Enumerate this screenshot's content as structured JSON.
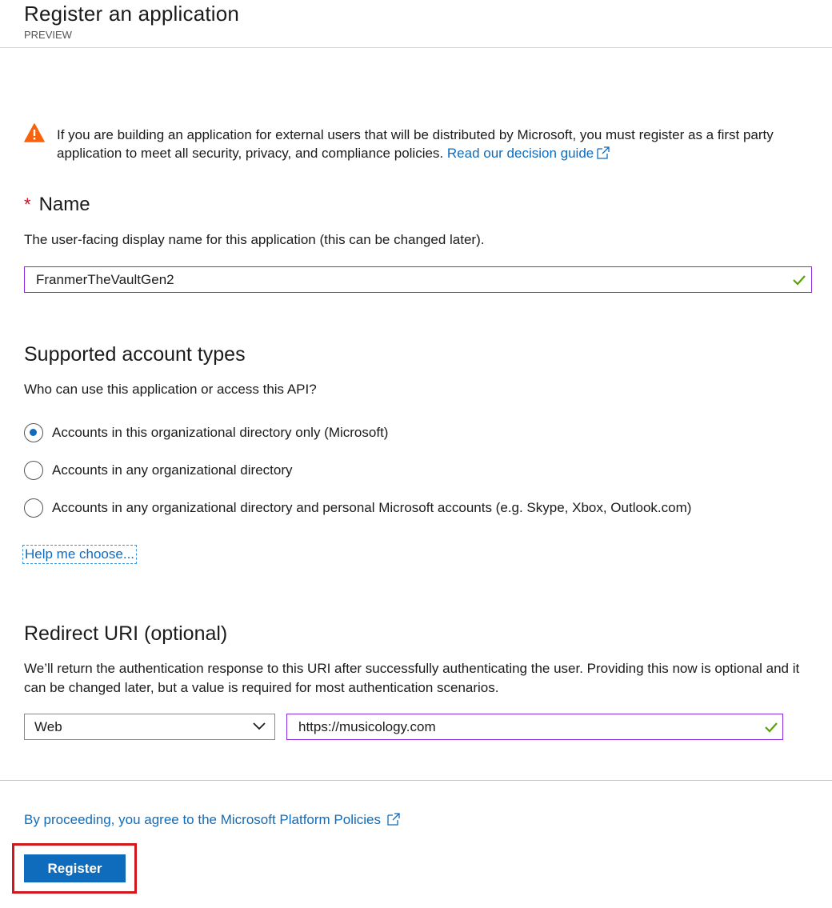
{
  "header": {
    "title": "Register an application",
    "subtitle": "PREVIEW"
  },
  "warning": {
    "icon": "warning-icon",
    "color": "#f7630c",
    "text": "If you are building an application for external users that will be distributed by Microsoft, you must register as a first party application to meet all security, privacy, and compliance policies.",
    "link_label": "Read our decision guide"
  },
  "name_section": {
    "required_marker": "*",
    "heading": "Name",
    "description": "The user-facing display name for this application (this can be changed later).",
    "value": "FranmerTheVaultGen2"
  },
  "account_types": {
    "heading": "Supported account types",
    "description": "Who can use this application or access this API?",
    "options": [
      {
        "label": "Accounts in this organizational directory only (Microsoft)",
        "selected": true
      },
      {
        "label": "Accounts in any organizational directory",
        "selected": false
      },
      {
        "label": "Accounts in any organizational directory and personal Microsoft accounts (e.g. Skype, Xbox, Outlook.com)",
        "selected": false
      }
    ],
    "help_link": "Help me choose..."
  },
  "redirect": {
    "heading": "Redirect URI (optional)",
    "description": "We’ll return the authentication response to this URI after successfully authenticating the user. Providing this now is optional and it can be changed later, but a value is required for most authentication scenarios.",
    "platform_value": "Web",
    "uri_value": "https://musicology.com"
  },
  "footer": {
    "policy_link": "By proceeding, you agree to the Microsoft Platform Policies",
    "register_label": "Register"
  },
  "colors": {
    "accent": "#0f6cbd",
    "valid_check": "#57a300",
    "focus_border": "#8a2be2",
    "highlight": "#d1181f"
  }
}
